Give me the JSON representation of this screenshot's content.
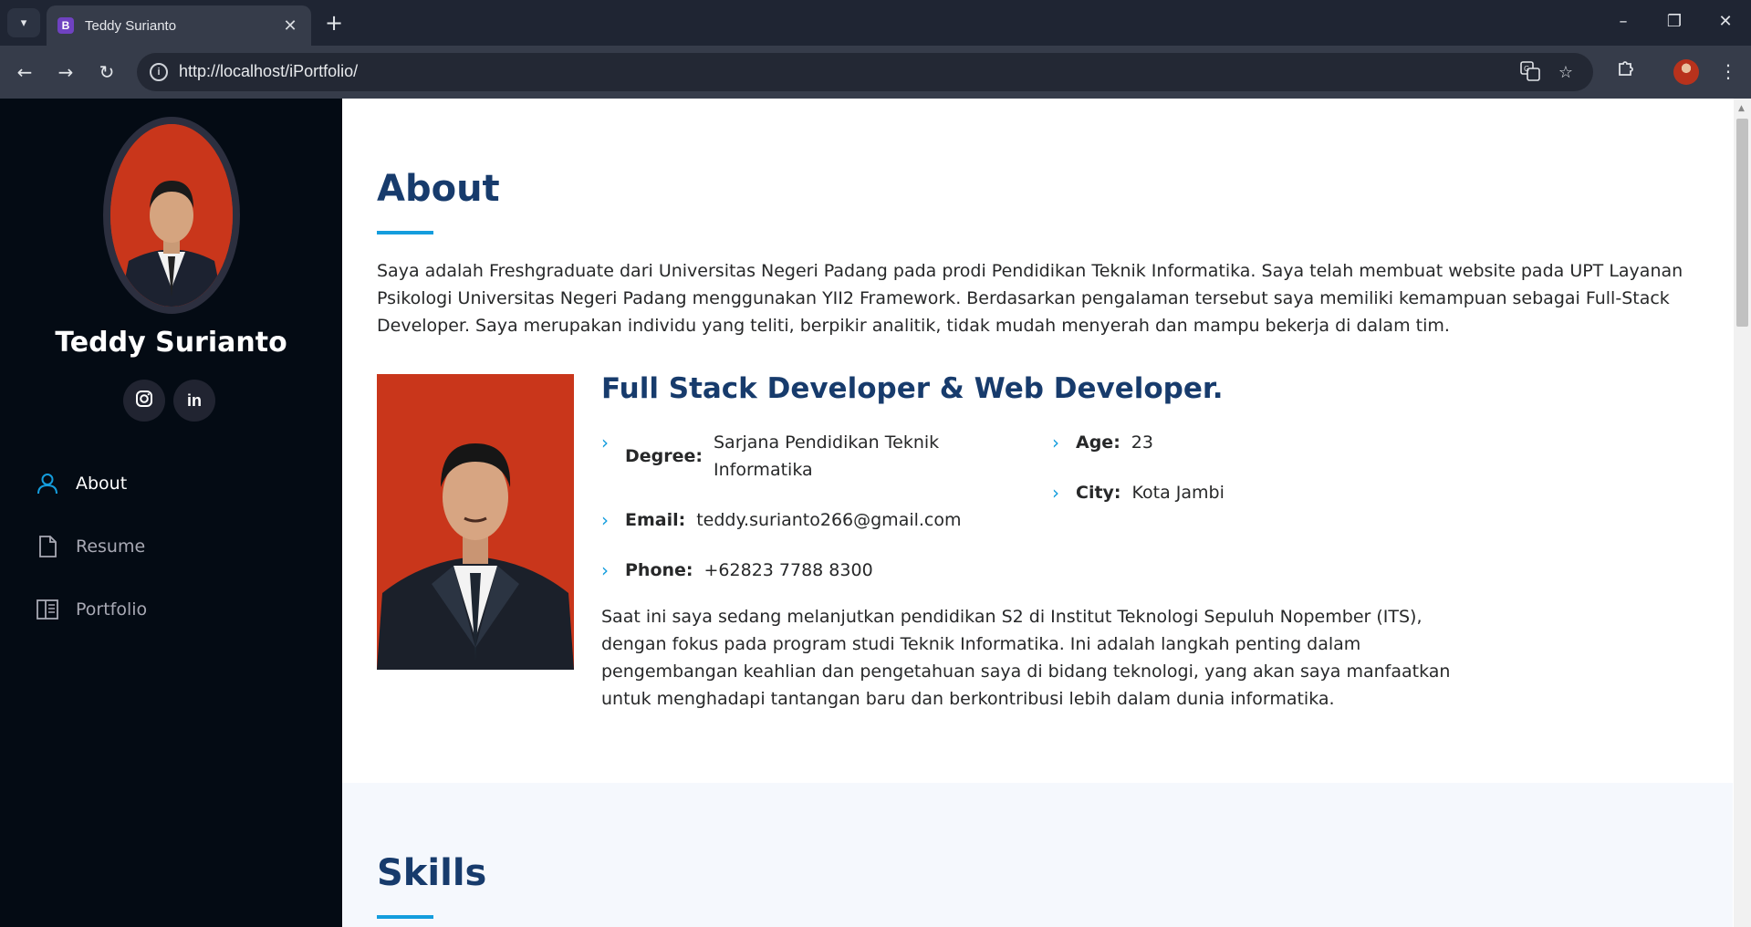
{
  "browser": {
    "tab_title": "Teddy Surianto",
    "tab_favicon_letter": "B",
    "url": "http://localhost/iPortfolio/"
  },
  "sidebar": {
    "name": "Teddy Surianto",
    "social": [
      {
        "name": "instagram-icon"
      },
      {
        "name": "linkedin-icon",
        "glyph": "in"
      }
    ],
    "nav": [
      {
        "label": "About",
        "icon": "person-icon",
        "active": true
      },
      {
        "label": "Resume",
        "icon": "file-icon",
        "active": false
      },
      {
        "label": "Portfolio",
        "icon": "book-icon",
        "active": false
      }
    ]
  },
  "about": {
    "title": "About",
    "intro": "Saya adalah Freshgraduate dari Universitas Negeri Padang pada prodi Pendidikan Teknik Informatika. Saya telah membuat website pada UPT Layanan Psikologi Universitas Negeri Padang menggunakan YII2 Framework. Berdasarkan pengalaman tersebut saya memiliki kemampuan sebagai Full-Stack Developer. Saya merupakan individu yang teliti, berpikir analitik, tidak mudah menyerah dan mampu bekerja di dalam tim.",
    "role": "Full Stack Developer & Web Developer.",
    "details": {
      "degree_label": "Degree:",
      "degree_value": "Sarjana Pendidikan Teknik Informatika",
      "email_label": "Email:",
      "email_value": "teddy.surianto266@gmail.com",
      "phone_label": "Phone:",
      "phone_value": "+62823 7788 8300",
      "age_label": "Age:",
      "age_value": "23",
      "city_label": "City:",
      "city_value": "Kota Jambi"
    },
    "extra": "Saat ini saya sedang melanjutkan pendidikan S2 di Institut Teknologi Sepuluh Nopember (ITS), dengan fokus pada program studi Teknik Informatika. Ini adalah langkah penting dalam pengembangan keahlian dan pengetahuan saya di bidang teknologi, yang akan saya manfaatkan untuk menghadapi tantangan baru dan berkontribusi lebih dalam dunia informatika."
  },
  "skills": {
    "title": "Skills"
  },
  "colors": {
    "accent": "#149ddd",
    "heading": "#173b6c",
    "sidebar_bg": "#040b14"
  }
}
